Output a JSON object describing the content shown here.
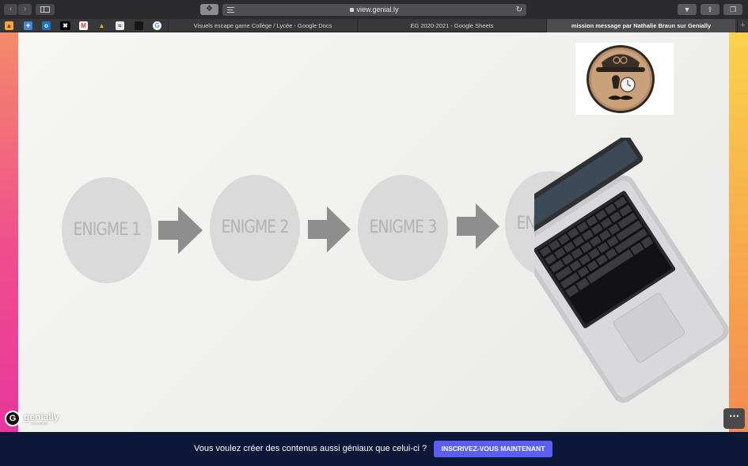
{
  "browser": {
    "url": "view.genial.ly",
    "tabs": [
      {
        "title": "Visuels escape game Collège / Lycée - Google Docs",
        "active": false
      },
      {
        "title": "EG 2020-2021 - Google Sheets",
        "active": false
      },
      {
        "title": "mission message par Nathalie Braun sur Genially",
        "active": true
      }
    ],
    "favorites": [
      "bookmark-icon",
      "twitter-icon",
      "outlook-icon",
      "xfinity-icon",
      "gmail-icon",
      "google-drive-icon",
      "photos-icon",
      "dark-icon",
      "google-icon"
    ]
  },
  "slide": {
    "steps": [
      "ENIGME 1",
      "ENIGME 2",
      "ENIGME 3",
      "ENIGME 4"
    ]
  },
  "brand": {
    "name": "genially",
    "tagline": "education"
  },
  "banner": {
    "text": "Vous voulez créer des contenus aussi géniaux que celui-ci ?",
    "cta": "INSCRIVEZ-VOUS MAINTENANT"
  },
  "colors": {
    "cta": "#5a5ef2",
    "banner_bg": "#0d1838",
    "circle": "#dadada",
    "arrow": "#8e8e8e"
  }
}
